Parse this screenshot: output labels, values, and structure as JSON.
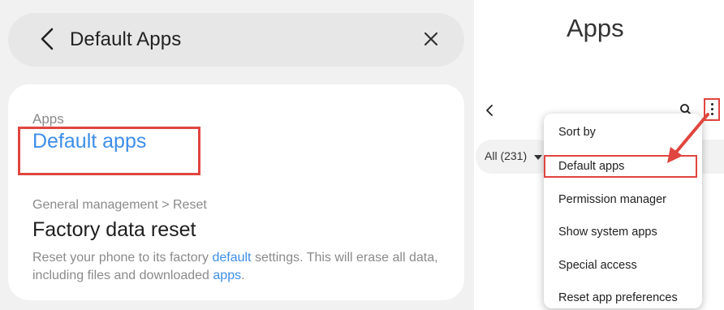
{
  "left": {
    "search": {
      "title": "Default Apps"
    },
    "results": [
      {
        "category": "Apps",
        "title": "Default apps"
      },
      {
        "category": "General management > Reset",
        "title": "Factory data reset",
        "description_parts": [
          "Reset your phone to its factory ",
          "default",
          " settings. This will erase all data, including files and downloaded ",
          "apps",
          "."
        ]
      }
    ]
  },
  "right": {
    "title": "Apps",
    "filter_label": "All (231)",
    "menu": {
      "items": [
        "Sort by",
        "Default apps",
        "Permission manager",
        "Show system apps",
        "Special access",
        "Reset app preferences"
      ],
      "highlighted_index": 1
    }
  },
  "colors": {
    "highlight_red": "#e1453f",
    "link_blue": "#3d8ee8",
    "panel_gray": "#f1f1f1"
  },
  "icons": {
    "back": "back-icon",
    "close": "close-icon",
    "search": "search-icon",
    "more": "more-vert-icon",
    "caret": "caret-down-icon"
  }
}
